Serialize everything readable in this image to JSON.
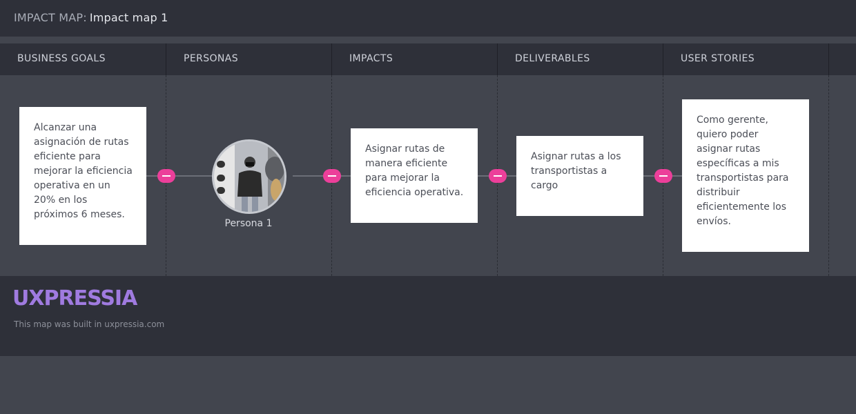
{
  "topbar": {
    "prefix": "IMPACT MAP:",
    "name": "Impact map 1"
  },
  "columns": [
    {
      "label": "BUSINESS GOALS"
    },
    {
      "label": "PERSONAS"
    },
    {
      "label": "IMPACTS"
    },
    {
      "label": "DELIVERABLES"
    },
    {
      "label": "USER STORIES"
    }
  ],
  "cards": {
    "business_goal": "Alcanzar una asignación de rutas eficiente para mejorar la eficiencia operativa en un 20% en los próximos 6 meses.",
    "impact": "Asignar rutas de manera eficiente para mejorar la eficiencia operativa.",
    "deliverable": "Asignar rutas a los transportistas a cargo",
    "user_story": "Como gerente, quiero poder asignar rutas específicas a mis transportistas para distribuir eficientemente los envíos."
  },
  "persona": {
    "name": "Persona 1",
    "avatar_icon": "person-photo-icon"
  },
  "colors": {
    "accent": "#ec3f9a",
    "brand": "#a07be0",
    "panel": "#2e3039",
    "background": "#42454e"
  },
  "footer": {
    "logo": "UXPRESSIA",
    "built_text": "This map was built in uxpressia.com"
  }
}
